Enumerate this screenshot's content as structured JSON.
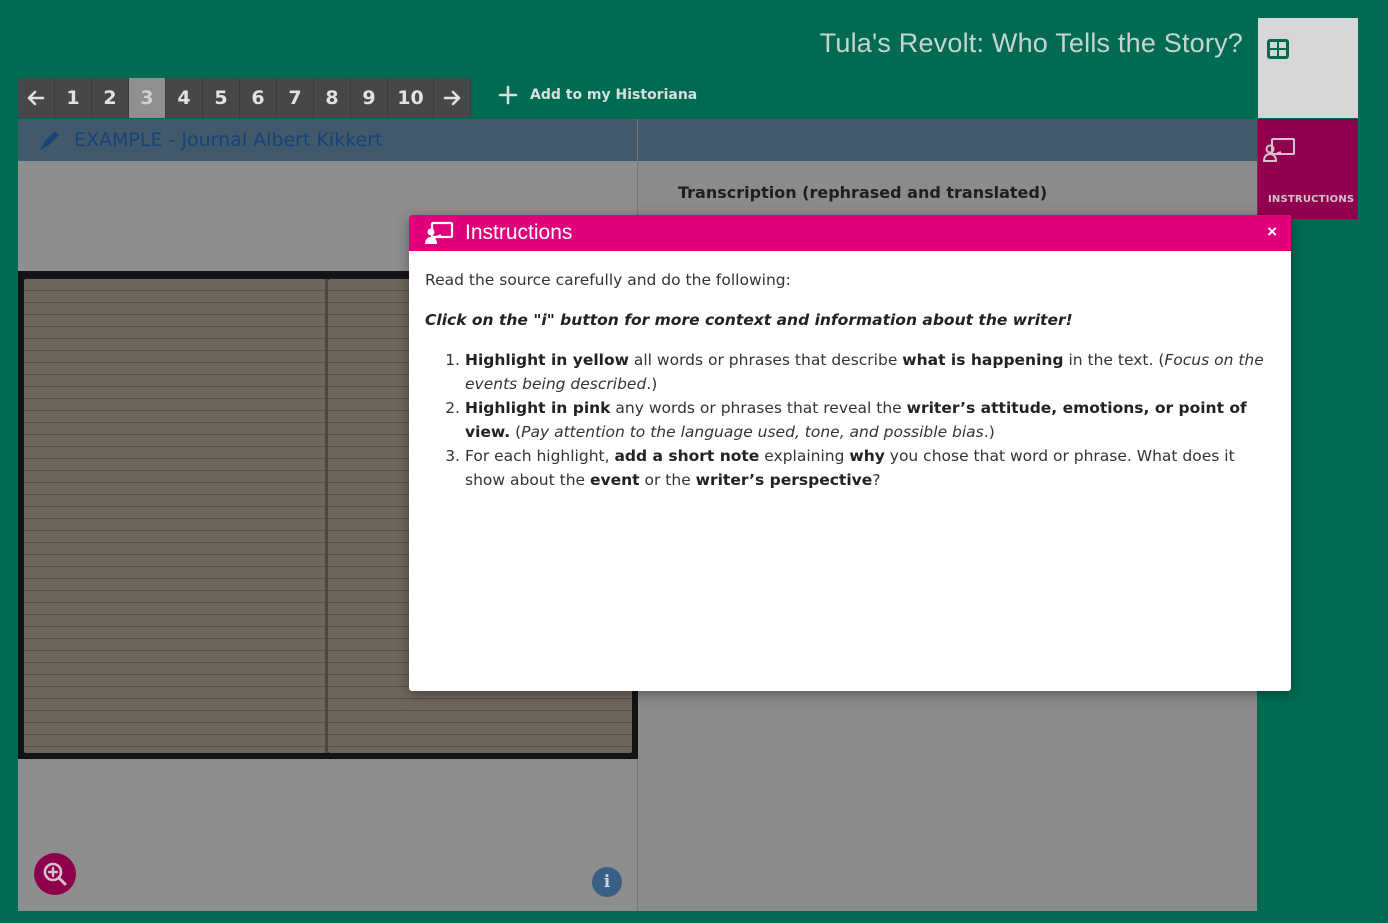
{
  "header": {
    "title": "Tula's Revolt: Who Tells the Story?"
  },
  "pager": {
    "prev_icon": "arrow-left-icon",
    "next_icon": "arrow-right-icon",
    "pages": [
      "1",
      "2",
      "3",
      "4",
      "5",
      "6",
      "7",
      "8",
      "9",
      "10"
    ],
    "active_page": "3"
  },
  "actions": {
    "add_to_historiana": "Add to my Historiana"
  },
  "side_tabs": {
    "instructions_label": "INSTRUCTIONS"
  },
  "source": {
    "title": "EXAMPLE - Journal Albert Kikkert"
  },
  "transcription": {
    "heading": "Transcription (rephrased and translated)"
  },
  "modal": {
    "title": "Instructions",
    "close": "×",
    "intro": "Read the source carefully and do the following:",
    "emphasis": "Click on the \"i\" button for more context and information about the writer!",
    "steps": [
      {
        "b1": "Highlight in yellow",
        "t1": " all words or phrases that describe ",
        "b2": "what is happening",
        "t2": " in the text. (",
        "i1": "Focus on the events being described",
        "t3": ".)"
      },
      {
        "b1": "Highlight in pink",
        "t1": " any words or phrases that reveal the ",
        "b2": "writer’s attitude, emotions, or point of view.",
        "t2": " (",
        "i1": "Pay attention to the language used, tone, and possible bias",
        "t3": ".)"
      },
      {
        "t0": "For each highlight, ",
        "b1": "add a short note",
        "t1": " explaining ",
        "b2": "why",
        "t2": " you chose that word or phrase. What does it show about the ",
        "b3": "event",
        "t3": " or the ",
        "b4": "writer’s perspective",
        "t4": "?"
      }
    ]
  },
  "buttons": {
    "info_label": "i"
  },
  "colors": {
    "background": "#006a52",
    "accent_pink": "#e0007b",
    "instructions_tab": "#91004f",
    "header_blue": "#16447a"
  }
}
